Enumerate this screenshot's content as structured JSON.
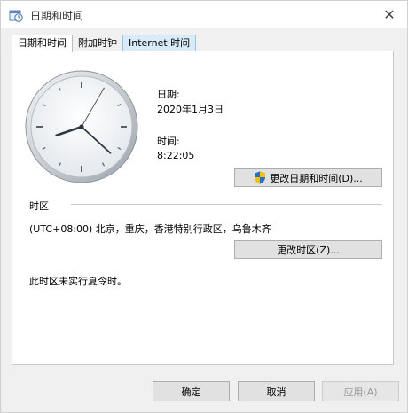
{
  "window": {
    "title": "日期和时间",
    "close_glyph": "✕"
  },
  "tabs": [
    {
      "label": "日期和时间",
      "active": true
    },
    {
      "label": "附加时钟",
      "active": false
    },
    {
      "label": "Internet 时间",
      "active": false
    }
  ],
  "clock": {
    "hour": 8,
    "minute": 22,
    "second": 5
  },
  "date": {
    "label": "日期:",
    "value": "2020年1月3日"
  },
  "time": {
    "label": "时间:",
    "value": "8:22:05"
  },
  "buttons": {
    "change_datetime": "更改日期和时间(D)...",
    "change_timezone": "更改时区(Z)..."
  },
  "timezone": {
    "heading": "时区",
    "value": "(UTC+08:00) 北京，重庆，香港特别行政区，乌鲁木齐",
    "dst_note": "此时区未实行夏令时。"
  },
  "footer": {
    "ok": "确定",
    "cancel": "取消",
    "apply": "应用(A)"
  },
  "colors": {
    "accent": "#0078d7",
    "tab_hover": "#d9ebf9"
  },
  "icons": {
    "title": "clock-calendar-icon",
    "shield": "uac-shield-icon"
  }
}
